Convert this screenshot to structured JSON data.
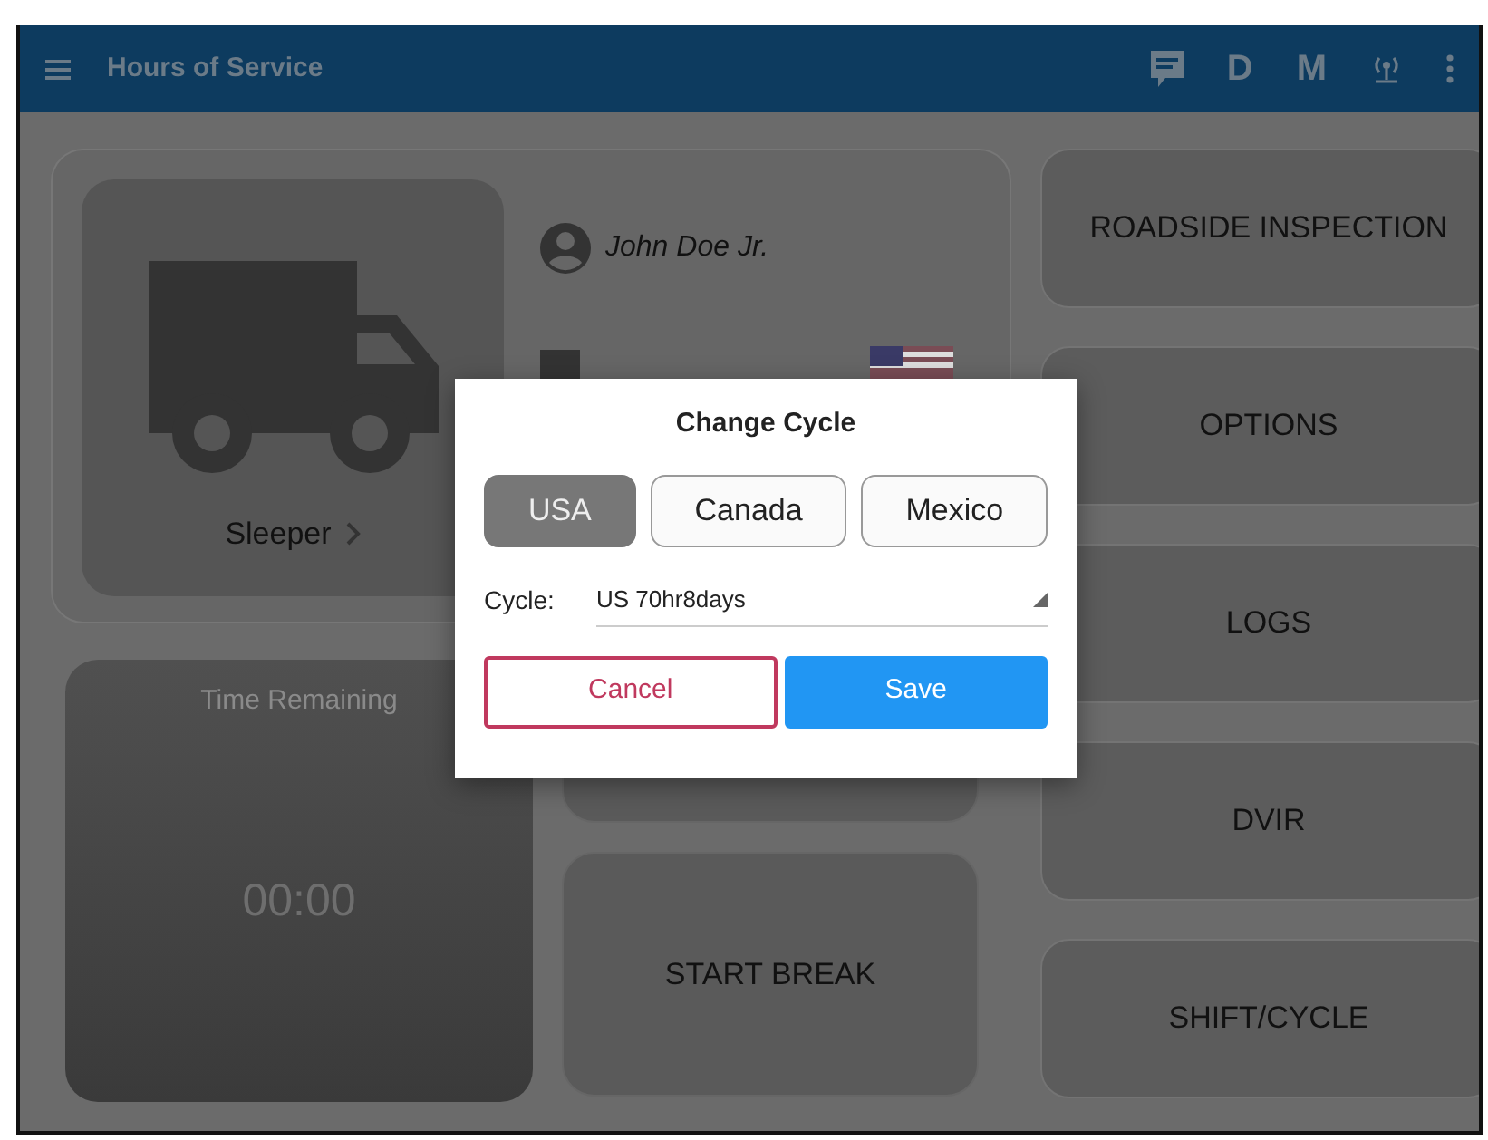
{
  "app_bar": {
    "title": "Hours of Service",
    "actions": [
      {
        "kind": "message"
      },
      {
        "kind": "letter",
        "label": "D"
      },
      {
        "kind": "letter",
        "label": "M"
      },
      {
        "kind": "signal"
      },
      {
        "kind": "more"
      }
    ]
  },
  "status_card": {
    "status": "Sleeper",
    "driver": "John Doe Jr."
  },
  "time_remaining": {
    "label": "Time Remaining",
    "value": "00:00"
  },
  "middle_buttons": [
    {
      "kind": "covered"
    },
    {
      "kind": "labeled",
      "label": "START BREAK"
    }
  ],
  "side_buttons": [
    {
      "label": "ROADSIDE INSPECTION"
    },
    {
      "label": "OPTIONS"
    },
    {
      "label": "LOGS"
    },
    {
      "label": "DVIR"
    },
    {
      "label": "SHIFT/CYCLE"
    }
  ],
  "dialog": {
    "title": "Change Cycle",
    "countries": [
      {
        "label": "USA",
        "selected": true
      },
      {
        "label": "Canada",
        "selected": false
      },
      {
        "label": "Mexico",
        "selected": false
      }
    ],
    "cycle_label": "Cycle:",
    "cycle_value": "US 70hr8days",
    "buttons": [
      {
        "kind": "cancel",
        "label": "Cancel"
      },
      {
        "kind": "save",
        "label": "Save"
      }
    ]
  }
}
